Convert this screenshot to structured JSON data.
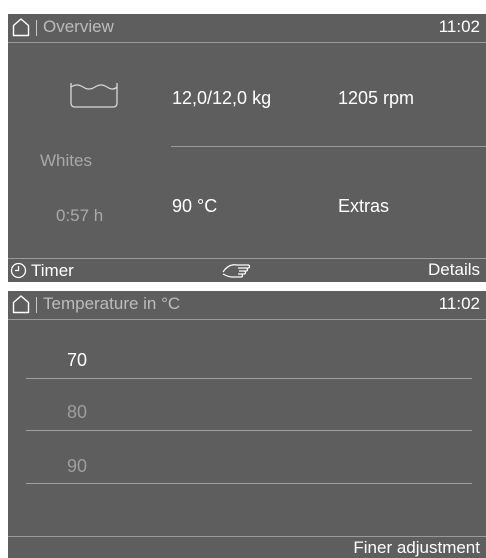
{
  "overview": {
    "title": "Overview",
    "time": "11:02",
    "program_icon": "wash-tub-icon",
    "program": "Whites",
    "duration": "0:57 h",
    "load": "12,0/12,0  kg",
    "spin": "1205 rpm",
    "temperature": "90 °C",
    "extras": "Extras",
    "footer": {
      "timer_icon": "clock-icon",
      "timer_label": "Timer",
      "center_icon": "hand-pointer-icon",
      "details_label": "Details"
    }
  },
  "temperature_menu": {
    "title": "Temperature in °C",
    "time": "11:02",
    "options": [
      "70",
      "80",
      "90"
    ],
    "selected": "70",
    "footer": {
      "finer_label": "Finer adjustment"
    }
  },
  "colors": {
    "panel": "#5e5e5e",
    "text": "#ffffff",
    "dim_text": "#a9a9a9",
    "divider": "#9a9a9a"
  }
}
